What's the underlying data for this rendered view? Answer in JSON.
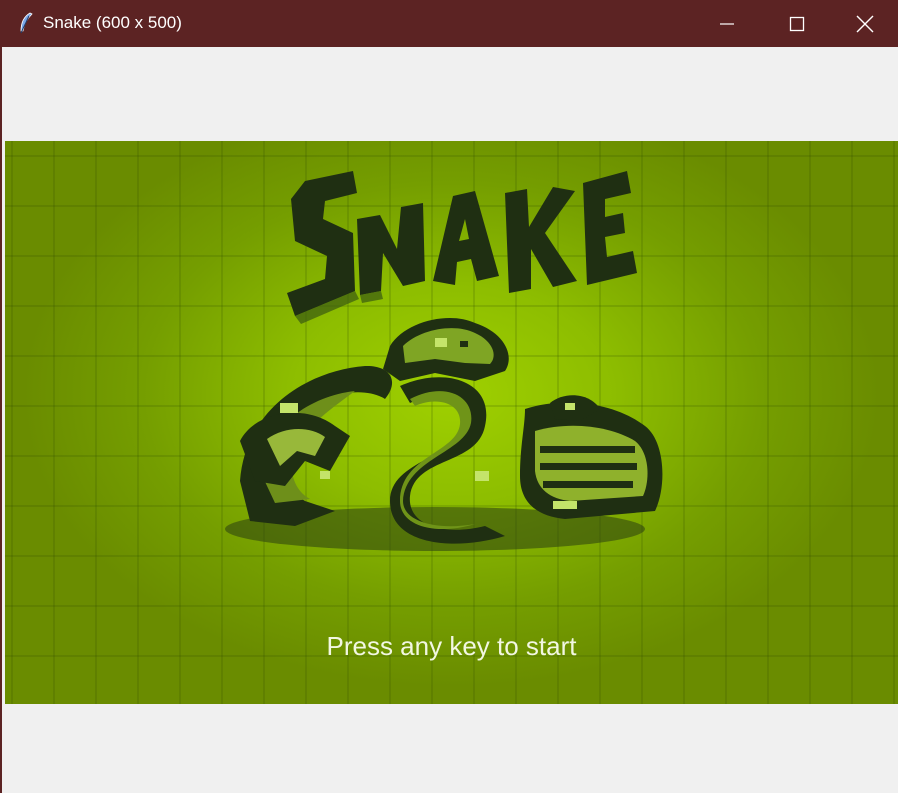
{
  "window": {
    "title": "Snake (600 x 500)",
    "icon": "feather-icon",
    "controls": [
      "minimize-icon",
      "maximize-icon",
      "close-icon"
    ],
    "titlebar_color": "#5c2323"
  },
  "game": {
    "logo_text": "SNAKE",
    "prompt": "Press any key to start",
    "colors": {
      "background_center": "#9fd000",
      "background_edge": "#6a8c00",
      "dark": "#1f2f12",
      "light": "#c4e46a",
      "prompt_text": "#f2f7e2"
    }
  }
}
